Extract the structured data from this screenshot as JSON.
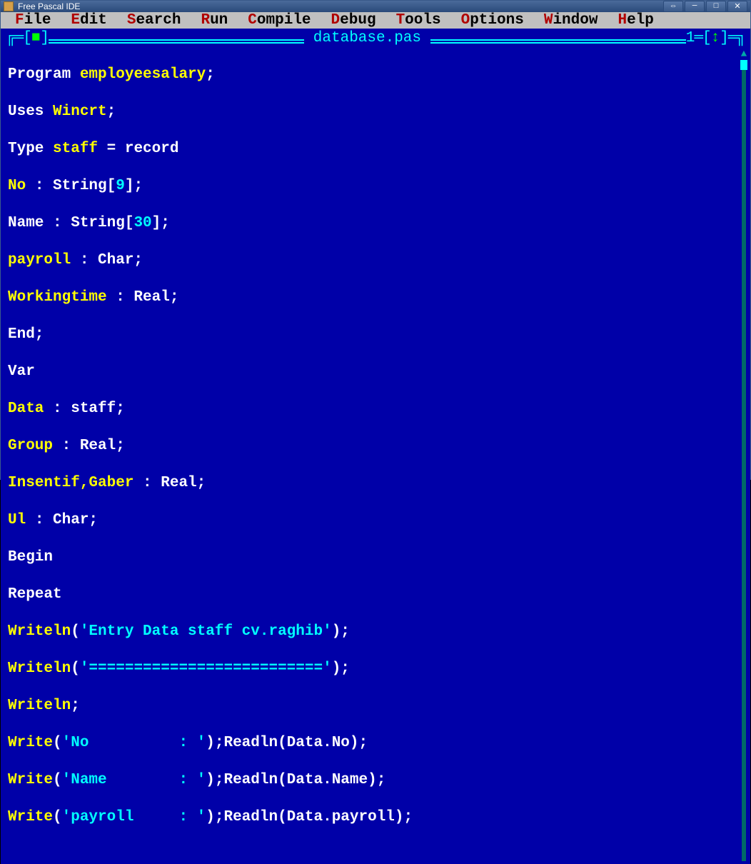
{
  "window": {
    "title": "Free Pascal IDE"
  },
  "menu": {
    "file": "File",
    "edit": "Edit",
    "search": "Search",
    "run": "Run",
    "compile": "Compile",
    "debug": "Debug",
    "tools": "Tools",
    "options": "Options",
    "windowm": "Window",
    "help": "Help"
  },
  "editor": {
    "filename": "database.pas",
    "window_number": "1"
  },
  "code": {
    "l1_kw": "Program ",
    "l1_id": "employeesalary",
    "l1_end": ";",
    "l2_kw": "Uses ",
    "l2_id": "Wincrt",
    "l2_end": ";",
    "l3_kw": "Type ",
    "l3_id": "staff",
    "l3_eq": " = ",
    "l3_rec": "record",
    "l4_id": "No",
    "l4_c": " : String[",
    "l4_n": "9",
    "l4_e": "];",
    "l5_id": "Name",
    "l5_c": " : String[",
    "l5_n": "30",
    "l5_e": "];",
    "l6_id": "payroll",
    "l6_c": " : Char;",
    "l7_id": "Workingtime",
    "l7_c": " : Real;",
    "l8": "End;",
    "l9": "Var",
    "l10_id": "Data",
    "l10_c": " : staff;",
    "l11_id": "Group",
    "l11_c": " : Real;",
    "l12_id": "Insentif,Gaber",
    "l12_c": " : Real;",
    "l13_id": "Ul",
    "l13_c": " : Char;",
    "l14": "Begin",
    "l15": "Repeat",
    "l16_fn": "Writeln",
    "l16_p": "(",
    "l16_s": "'Entry Data staff cv.raghib'",
    "l16_e": ");",
    "l17_fn": "Writeln",
    "l17_p": "(",
    "l17_s": "'=========================='",
    "l17_e": ");",
    "l18_fn": "Writeln",
    "l18_e": ";",
    "l19_fn": "Write",
    "l19_p": "(",
    "l19_s": "'No          : '",
    "l19_m": ");Readln(Data.No);",
    "l20_fn": "Write",
    "l20_p": "(",
    "l20_s": "'Name        : '",
    "l20_m": ");Readln(Data.Name);",
    "l21_fn": "Write",
    "l21_p": "(",
    "l21_s": "'payroll     : '",
    "l21_m": ");Readln(Data.payroll);"
  }
}
